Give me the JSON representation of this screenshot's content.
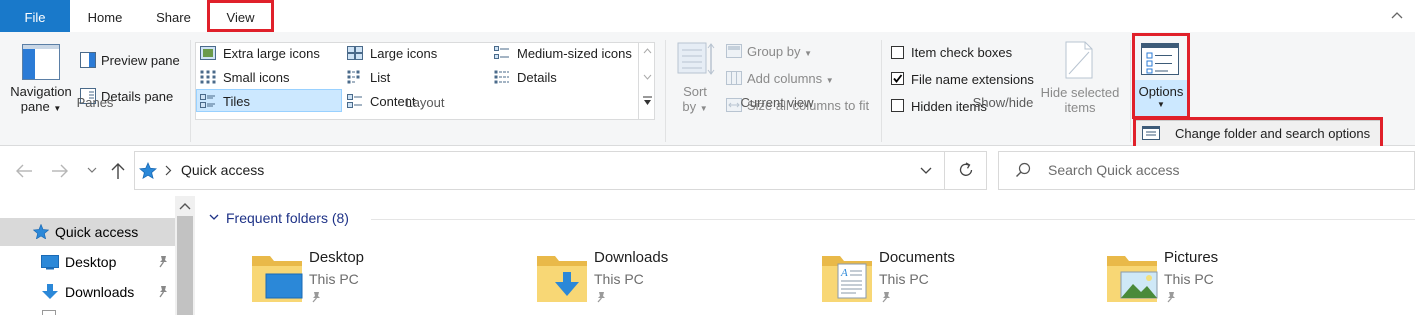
{
  "tabs": {
    "file": "File",
    "home": "Home",
    "share": "Share",
    "view": "View"
  },
  "panes": {
    "navigation_pane_line1": "Navigation",
    "navigation_pane_line2": "pane",
    "preview_pane": "Preview pane",
    "details_pane": "Details pane",
    "group_label": "Panes"
  },
  "layout": {
    "extra_large_icons": "Extra large icons",
    "large_icons": "Large icons",
    "medium_icons": "Medium-sized icons",
    "small_icons": "Small icons",
    "list": "List",
    "details": "Details",
    "tiles": "Tiles",
    "content": "Content",
    "group_label": "Layout"
  },
  "current_view": {
    "sort_by_line1": "Sort",
    "sort_by_line2": "by",
    "group_by": "Group by",
    "add_columns": "Add columns",
    "size_all_columns": "Size all columns to fit",
    "group_label": "Current view"
  },
  "show_hide": {
    "item_check_boxes": "Item check boxes",
    "file_name_extensions": "File name extensions",
    "hidden_items": "Hidden items",
    "hide_selected_line1": "Hide selected",
    "hide_selected_line2": "items",
    "group_label": "Show/hide",
    "item_check_boxes_checked": false,
    "file_name_extensions_checked": true,
    "hidden_items_checked": false
  },
  "options": {
    "label": "Options",
    "menu_item": "Change folder and search options"
  },
  "address": {
    "path": "Quick access"
  },
  "search": {
    "placeholder": "Search Quick access"
  },
  "sidebar": {
    "items": [
      {
        "label": "Quick access",
        "icon": "star-icon"
      },
      {
        "label": "Desktop",
        "icon": "desktop-icon"
      },
      {
        "label": "Downloads",
        "icon": "download-icon"
      }
    ]
  },
  "content": {
    "section_header": "Frequent folders (8)",
    "folders": [
      {
        "name": "Desktop",
        "location": "This PC"
      },
      {
        "name": "Downloads",
        "location": "This PC"
      },
      {
        "name": "Documents",
        "location": "This PC"
      },
      {
        "name": "Pictures",
        "location": "This PC"
      }
    ]
  },
  "colors": {
    "accent": "#1979ca",
    "highlight_red": "#e0202a",
    "selected_tile_bg": "#cce8ff",
    "sidebar_selected_bg": "#d9d9d9",
    "folder_yellow": "#f8d775"
  }
}
